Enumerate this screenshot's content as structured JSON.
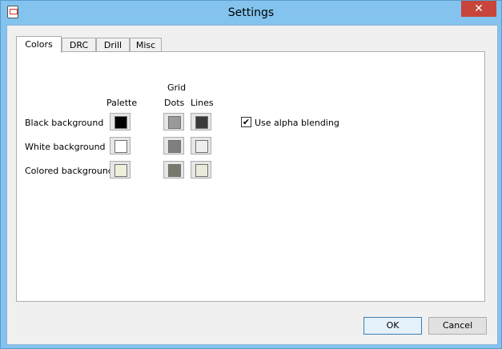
{
  "window": {
    "title": "Settings",
    "close_glyph": "✕"
  },
  "tabs": [
    {
      "label": "Colors",
      "active": true
    },
    {
      "label": "DRC",
      "active": false
    },
    {
      "label": "Drill",
      "active": false
    },
    {
      "label": "Misc",
      "active": false
    }
  ],
  "colors_tab": {
    "header_palette": "Palette",
    "header_grid": "Grid",
    "header_dots": "Dots",
    "header_lines": "Lines",
    "rows": [
      {
        "label": "Black background",
        "palette": "#000000",
        "dots": "#9a9a9a",
        "lines": "#3a3a3a"
      },
      {
        "label": "White background",
        "palette": "#ffffff",
        "dots": "#7f7f7f",
        "lines": "#eeeeee"
      },
      {
        "label": "Colored background",
        "palette": "#efefdc",
        "dots": "#78786c",
        "lines": "#ebebdc"
      }
    ],
    "alpha_blending": {
      "label": "Use alpha blending",
      "checked": true,
      "check_glyph": "✔"
    }
  },
  "buttons": {
    "ok": "OK",
    "cancel": "Cancel"
  },
  "icons": {
    "app": "app-icon",
    "close": "close-icon",
    "check": "check-icon"
  }
}
